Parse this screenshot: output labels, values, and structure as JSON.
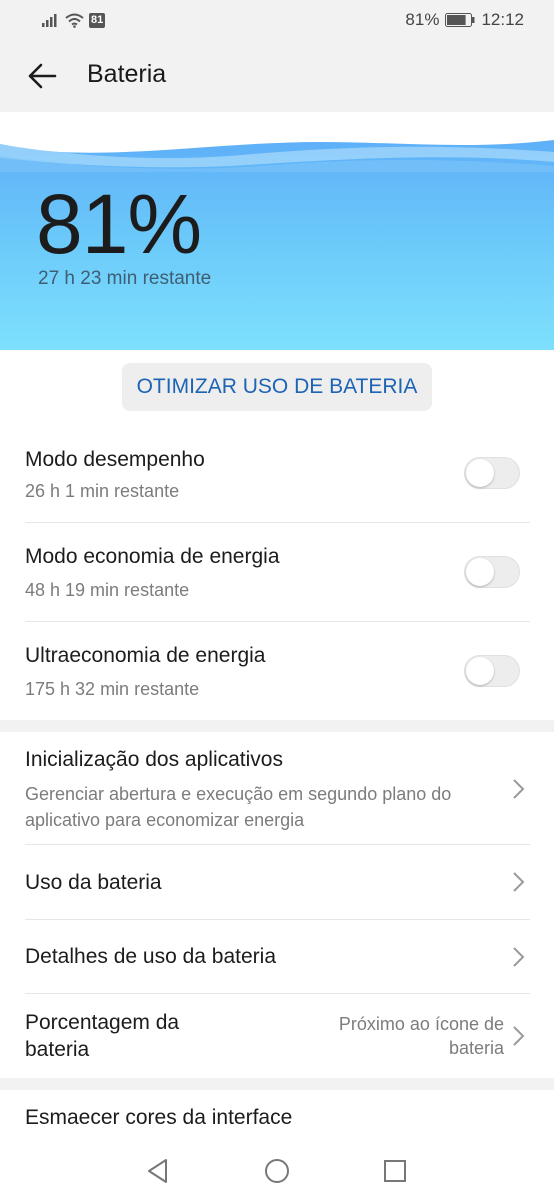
{
  "status_bar": {
    "sim_badge": "81",
    "battery_percent": "81%",
    "time": "12:12",
    "battery_level": 0.81
  },
  "app_bar": {
    "title": "Bateria"
  },
  "hero": {
    "battery_percent": "81%",
    "remaining": "27 h 23 min restante"
  },
  "optimize_button": {
    "label": "OTIMIZAR USO DE BATERIA"
  },
  "modes": [
    {
      "title": "Modo desempenho",
      "subtitle": "26 h 1 min restante",
      "enabled": false
    },
    {
      "title": "Modo economia de energia",
      "subtitle": "48 h 19 min restante",
      "enabled": false
    },
    {
      "title": "Ultraeconomia de energia",
      "subtitle": "175 h 32 min restante",
      "enabled": false
    }
  ],
  "settings": {
    "app_launch": {
      "title": "Inicialização dos aplicativos",
      "subtitle_line1": "Gerenciar abertura e execução em segundo plano do",
      "subtitle_line2": "aplicativo para economizar energia"
    },
    "battery_usage": {
      "title": "Uso da bateria"
    },
    "usage_details": {
      "title": "Detalhes de uso da bateria"
    },
    "battery_percentage": {
      "title_line1": "Porcentagem da",
      "title_line2": "bateria",
      "value_line1": "Próximo ao ícone de",
      "value_line2": "bateria"
    },
    "dim_colors": {
      "title": "Esmaecer cores da interface"
    }
  },
  "colors": {
    "accent": "#1e64b4",
    "hero_top": "#5aa8f7",
    "hero_bottom": "#7ee0fd"
  },
  "icons": {
    "signal": "signal-icon",
    "wifi": "wifi-icon",
    "battery": "battery-icon",
    "back": "arrow-left-icon",
    "chevron": "chevron-right-icon",
    "nav_back": "triangle-back-icon",
    "nav_home": "circle-home-icon",
    "nav_recents": "square-recents-icon"
  }
}
